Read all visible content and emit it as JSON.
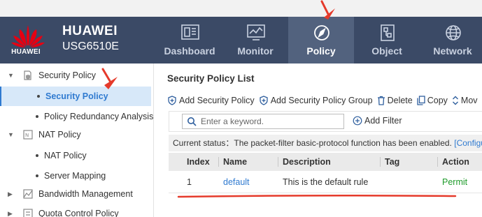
{
  "brand": {
    "logo_text": "HUAWEI",
    "name": "HUAWEI",
    "model": "USG6510E",
    "logo_color": "#e60012"
  },
  "nav": {
    "items": [
      {
        "label": "Dashboard",
        "icon": "dashboard-icon"
      },
      {
        "label": "Monitor",
        "icon": "monitor-icon"
      },
      {
        "label": "Policy",
        "icon": "compass-icon",
        "active": true
      },
      {
        "label": "Object",
        "icon": "object-icon"
      },
      {
        "label": "Network",
        "icon": "globe-icon"
      }
    ],
    "header_color": "#3b4a66",
    "active_color": "#52627e"
  },
  "sidebar": {
    "items": [
      {
        "label": "Security Policy",
        "type": "group",
        "expanded": true
      },
      {
        "label": "Security Policy",
        "type": "child",
        "selected": true
      },
      {
        "label": "Policy Redundancy Analysis",
        "type": "child"
      },
      {
        "label": "NAT Policy",
        "type": "group",
        "expanded": true
      },
      {
        "label": "NAT Policy",
        "type": "child"
      },
      {
        "label": "Server Mapping",
        "type": "child"
      },
      {
        "label": "Bandwidth Management",
        "type": "group",
        "expanded": false
      },
      {
        "label": "Quota Control Policy",
        "type": "group",
        "expanded": false
      }
    ]
  },
  "main": {
    "title": "Security Policy List",
    "toolbar": {
      "add_policy": "Add Security Policy",
      "add_group": "Add Security Policy Group",
      "delete": "Delete",
      "copy": "Copy",
      "move": "Mov"
    },
    "search": {
      "placeholder": "Enter a keyword.",
      "add_filter": "Add Filter"
    },
    "status": {
      "text": "Current status：The packet-filter basic-protocol function has been enabled.",
      "link": "[Configu"
    },
    "table": {
      "columns": [
        "Index",
        "Name",
        "Description",
        "Tag",
        "Action"
      ],
      "rows": [
        {
          "index": "1",
          "name": "default",
          "description": "This is the default rule",
          "tag": "",
          "action": "Permit"
        }
      ]
    },
    "accent_color": "#2f7ad0",
    "permit_color": "#1e9b2a",
    "annotation_color": "#e53a2b"
  }
}
